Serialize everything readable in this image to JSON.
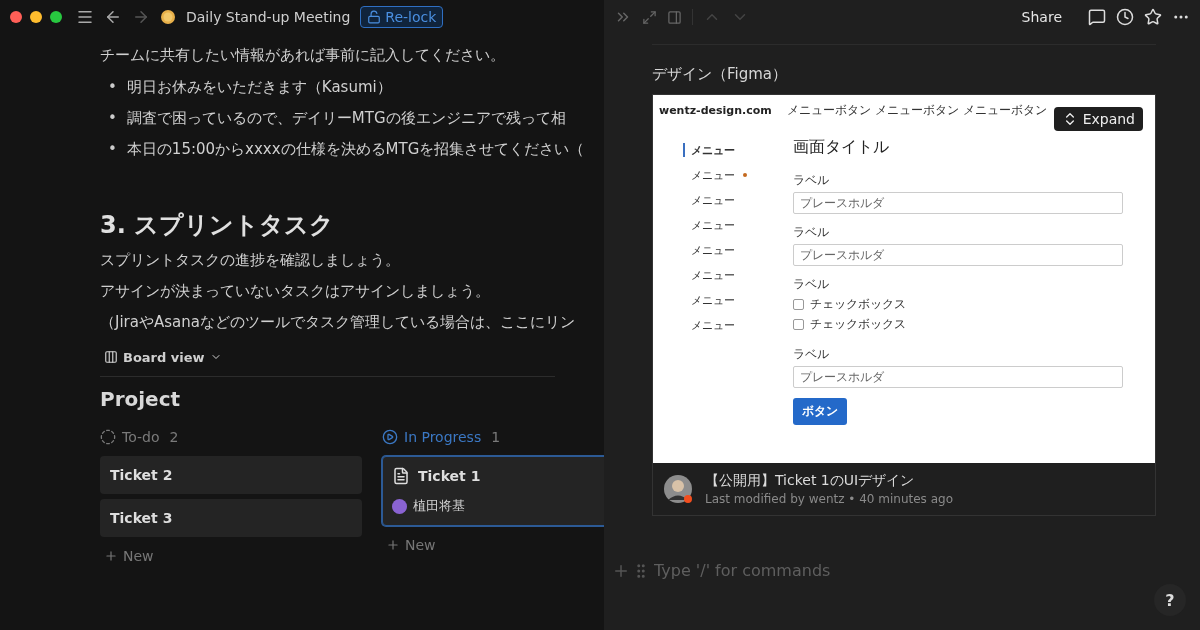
{
  "window": {
    "title": "Daily Stand-up Meeting",
    "lock_button": "Re-lock",
    "forward_disabled": true
  },
  "page": {
    "intro": "チームに共有したい情報があれば事前に記入してください。",
    "bullets": [
      {
        "marker": "•",
        "text": "明日お休みをいただきます（Kasumi）"
      },
      {
        "marker": "•",
        "text": "調査で困っているので、デイリーMTGの後エンジニアで残って相"
      },
      {
        "marker": "•",
        "text": "本日の15:00からxxxxの仕様を決めるMTGを招集させてください（"
      }
    ],
    "heading": "3. スプリントタスク",
    "paragraphs": [
      "スプリントタスクの進捗を確認しましょう。",
      "アサインが決まっていないタスクはアサインしましょう。",
      "（JiraやAsanaなどのツールでタスク管理している場合は、ここにリン"
    ],
    "view_tab": "Board view",
    "database_title": "Project",
    "columns": [
      {
        "kind": "todo",
        "name": "To-do",
        "count": "2",
        "new_label": "New",
        "cards": [
          {
            "title": "Ticket 2",
            "selected": false,
            "has_content": false
          },
          {
            "title": "Ticket 3",
            "selected": false,
            "has_content": false
          }
        ]
      },
      {
        "kind": "in_progress",
        "name": "In Progress",
        "count": "1",
        "new_label": "New",
        "cards": [
          {
            "title": "Ticket 1",
            "selected": true,
            "has_content": true,
            "assignee": "植田将基"
          }
        ]
      }
    ]
  },
  "peek": {
    "share": "Share",
    "up_disabled": true,
    "down_disabled": true,
    "embed_title": "デザイン（Figma）",
    "expand": "Expand",
    "figma": {
      "site": "wentz-design.com",
      "nav": [
        "メニューボタン",
        "メニューボタン",
        "メニューボタン"
      ],
      "menu": [
        {
          "label": "メニュー",
          "selected": true,
          "badge": false
        },
        {
          "label": "メニュー",
          "selected": false,
          "badge": true
        },
        {
          "label": "メニュー",
          "selected": false,
          "badge": false
        },
        {
          "label": "メニュー",
          "selected": false,
          "badge": false
        },
        {
          "label": "メニュー",
          "selected": false,
          "badge": false
        },
        {
          "label": "メニュー",
          "selected": false,
          "badge": false
        },
        {
          "label": "メニュー",
          "selected": false,
          "badge": false
        },
        {
          "label": "メニュー",
          "selected": false,
          "badge": false
        }
      ],
      "title": "画面タイトル",
      "fields": [
        {
          "kind": "input",
          "label": "ラベル",
          "placeholder": "プレースホルダ"
        },
        {
          "kind": "input",
          "label": "ラベル",
          "placeholder": "プレースホルダ"
        },
        {
          "kind": "checkboxes",
          "label": "ラベル",
          "options": [
            {
              "label": "チェックボックス",
              "checked": false
            },
            {
              "label": "チェックボックス",
              "checked": false
            }
          ]
        },
        {
          "kind": "input",
          "label": "ラベル",
          "placeholder": "プレースホルダ"
        }
      ],
      "button": "ボタン"
    },
    "file": {
      "title": "【公開用】Ticket 1のUIデザイン",
      "meta": "Last modified by wentz • 40 minutes ago"
    },
    "command_placeholder": "Type '/' for commands",
    "help": "?"
  }
}
